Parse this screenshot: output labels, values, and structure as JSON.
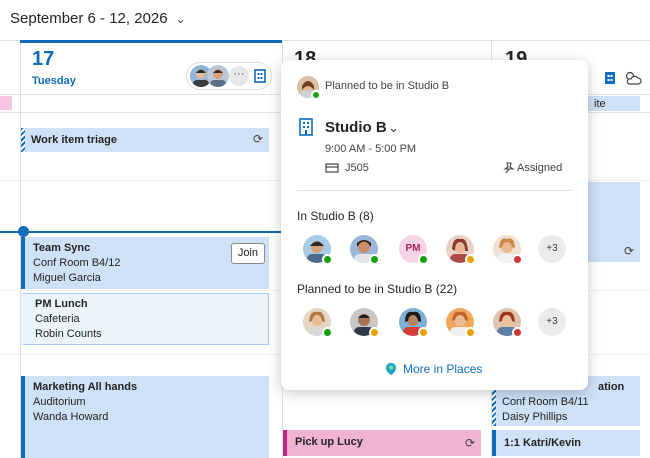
{
  "header": {
    "date_range": "September 6 - 12, 2026"
  },
  "days": [
    {
      "num": "17",
      "name": "Tuesday"
    },
    {
      "num": "18"
    },
    {
      "num": "19"
    }
  ],
  "right_col_text": {
    "top_partial": "ite",
    "event_partial_title": "ation",
    "event_partial_room": "Conf Room B4/11",
    "event_partial_person": "Daisy Phillips",
    "event_partial2": "1:1 Katri/Kevin"
  },
  "events": {
    "triage": {
      "title": "Work item triage"
    },
    "sync": {
      "title": "Team Sync",
      "room": "Conf Room B4/12",
      "person": "Miguel Garcia",
      "join": "Join"
    },
    "lunch": {
      "title": "PM Lunch",
      "room": "Cafeteria",
      "person": "Robin Counts"
    },
    "allhands": {
      "title": "Marketing All hands",
      "room": "Auditorium",
      "person": "Wanda Howard"
    },
    "pickup": {
      "title": "Pick up Lucy"
    }
  },
  "popup": {
    "planned_label": "Planned to be in Studio B",
    "studio_name": "Studio B",
    "time": "9:00 AM - 5:00 PM",
    "desk": "J505",
    "assigned": "Assigned",
    "section_in": "In Studio B (8)",
    "section_planned": "Planned to be in Studio B (22)",
    "in_more": "+3",
    "planned_more": "+3",
    "initials": "PM",
    "more_link": "More in Places"
  },
  "colors": {
    "accent": "#0f6cbd",
    "event_bg": "#cfe1f7",
    "pink": "#f1b3d3"
  }
}
